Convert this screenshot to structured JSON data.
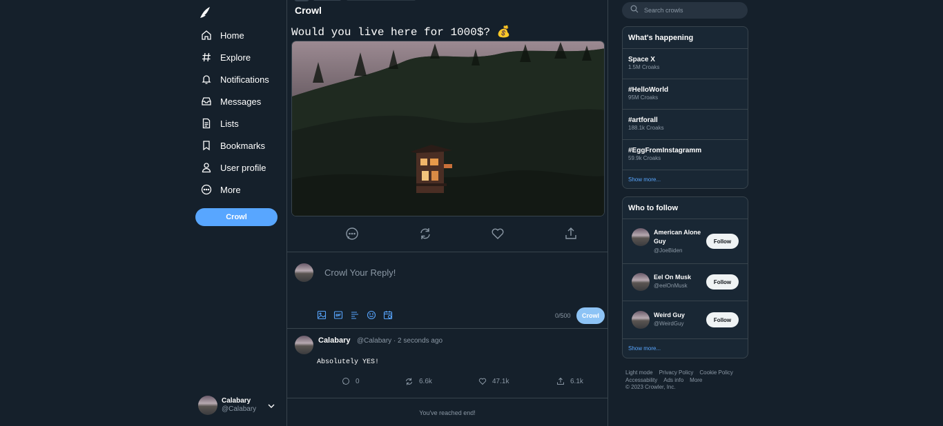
{
  "nav": {
    "items": [
      {
        "label": "Home",
        "icon": "home-icon"
      },
      {
        "label": "Explore",
        "icon": "hash-icon"
      },
      {
        "label": "Notifications",
        "icon": "bell-icon"
      },
      {
        "label": "Messages",
        "icon": "inbox-icon"
      },
      {
        "label": "Lists",
        "icon": "list-doc-icon"
      },
      {
        "label": "Bookmarks",
        "icon": "bookmark-icon"
      },
      {
        "label": "User profile",
        "icon": "user-icon"
      },
      {
        "label": "More",
        "icon": "more-circle-icon"
      }
    ],
    "crowl_button": "Crowl"
  },
  "account": {
    "name": "Calabary",
    "handle": "@Calabary"
  },
  "header": {
    "title": "Crowl"
  },
  "tweet": {
    "text": "Would you live here for 1000$? 💰"
  },
  "reply": {
    "placeholder": "Crowl Your Reply!",
    "counter": "0/500",
    "button": "Crowl"
  },
  "comment": {
    "name": "Calabary",
    "meta": "@Calabary · 2 seconds ago",
    "text": "Absolutely YES!",
    "replies": "0",
    "recrowls": "6.6k",
    "likes": "47.1k",
    "shares": "6.1k"
  },
  "end_text": "You've reached end!",
  "search": {
    "placeholder": "Search crowls"
  },
  "trends": {
    "title": "What's happening",
    "items": [
      {
        "topic": "Space X",
        "count": "1.5M Croaks"
      },
      {
        "topic": "#HelloWorld",
        "count": "95M Croaks"
      },
      {
        "topic": "#artforall",
        "count": "188.1k Croaks"
      },
      {
        "topic": "#EggFromInstagramm",
        "count": "59.9k Croaks"
      }
    ],
    "show_more": "Show more..."
  },
  "who_to_follow": {
    "title": "Who to follow",
    "users": [
      {
        "name": "American Alone Guy",
        "handle": "@JoeBiden",
        "button": "Follow"
      },
      {
        "name": "Eel On Musk",
        "handle": "@eelOnMusk",
        "button": "Follow"
      },
      {
        "name": "Weird Guy",
        "handle": "@WeirdGuy",
        "button": "Follow"
      }
    ],
    "show_more": "Show more..."
  },
  "footer": {
    "links": [
      "Light mode",
      "Privacy Policy",
      "Cookie Policy",
      "Accessability",
      "Ads info",
      "More"
    ],
    "copyright": "© 2023 Crowler, Inc."
  },
  "colors": {
    "background": "#15202b",
    "accent": "#58a6ff",
    "border": "#38444d",
    "muted": "#8b98a5"
  }
}
